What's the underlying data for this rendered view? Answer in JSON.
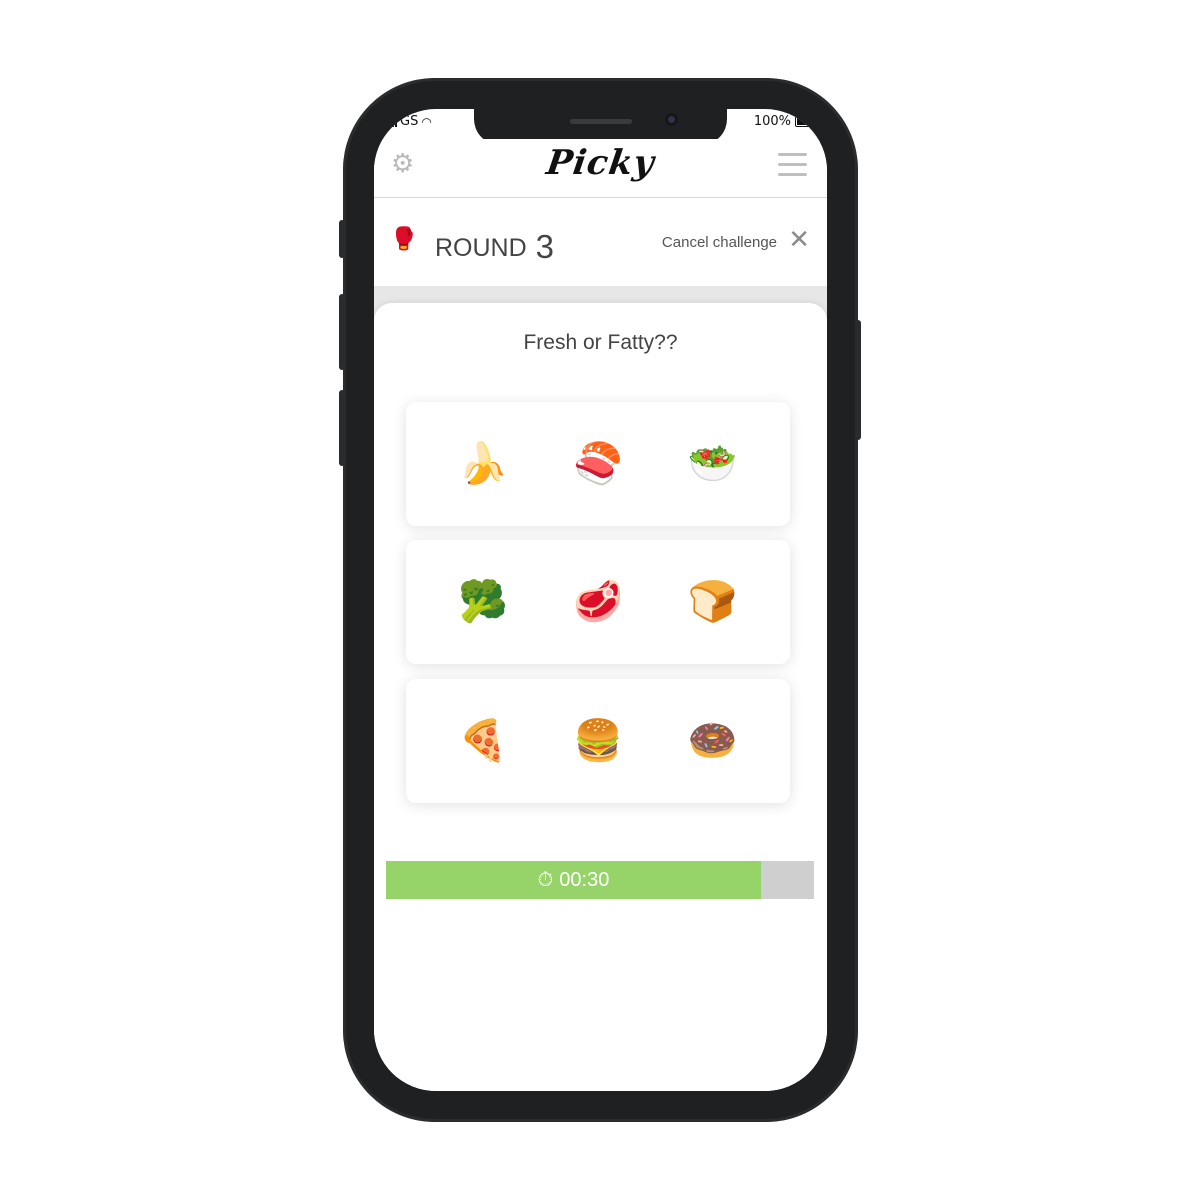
{
  "status": {
    "carrier": "GS",
    "battery": "100%"
  },
  "app": {
    "logo": "Picky",
    "settings_icon": "gear-icon",
    "menu_icon": "hamburger-icon"
  },
  "round": {
    "icon": "boxing-glove-icon",
    "label": "ROUND",
    "number": "3",
    "cancel_label": "Cancel challenge",
    "close_icon": "close-icon"
  },
  "question": "Fresh or Fatty??",
  "cards": [
    {
      "items": [
        "🍌",
        "🍣",
        "🥗"
      ]
    },
    {
      "items": [
        "🥦",
        "🥩",
        "🍞"
      ]
    },
    {
      "items": [
        "🍕",
        "🍔",
        "🍩"
      ]
    }
  ],
  "timer": {
    "icon": "stopwatch-icon",
    "text": "00:30",
    "progress": 0.875,
    "fill_color": "#96d46a",
    "track_color": "#cfcfcf"
  }
}
